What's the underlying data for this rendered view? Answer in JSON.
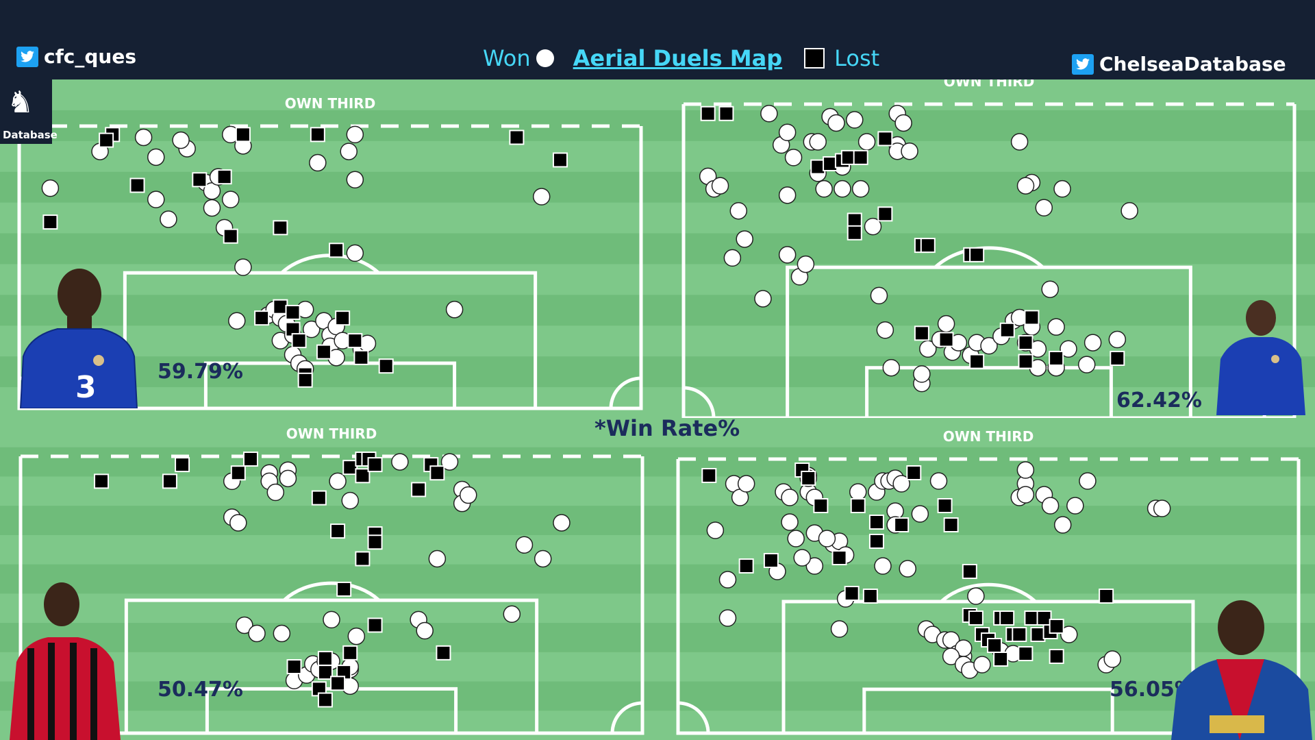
{
  "header": {
    "left_handle": "cfc_ques",
    "right_handle": "ChelseaDatabase",
    "won_label": "Won",
    "title": "Aerial Duels Map",
    "lost_label": "Lost"
  },
  "logo": {
    "text": "Database"
  },
  "win_rate_label": "*Win Rate%",
  "colors": {
    "pitch_dark": "#6fbc7a",
    "pitch_light": "#7ec889",
    "header_bg": "#152033",
    "legend_cyan": "#46d7f7",
    "percent_navy": "#1b2c5c"
  },
  "panels": [
    {
      "zone_label": "OWN THIRD",
      "win_rate": "59.79%",
      "player_kit": "blue",
      "won": [
        [
          0.05,
          0.22
        ],
        [
          0.13,
          0.09
        ],
        [
          0.2,
          0.04
        ],
        [
          0.22,
          0.11
        ],
        [
          0.22,
          0.26
        ],
        [
          0.24,
          0.33
        ],
        [
          0.27,
          0.08
        ],
        [
          0.3,
          0.2
        ],
        [
          0.31,
          0.23
        ],
        [
          0.31,
          0.29
        ],
        [
          0.32,
          0.18
        ],
        [
          0.33,
          0.36
        ],
        [
          0.34,
          0.03
        ],
        [
          0.34,
          0.26
        ],
        [
          0.36,
          0.07
        ],
        [
          0.36,
          0.5
        ],
        [
          0.4,
          0.67
        ],
        [
          0.41,
          0.65
        ],
        [
          0.42,
          0.68
        ],
        [
          0.42,
          0.76
        ],
        [
          0.43,
          0.7
        ],
        [
          0.44,
          0.74
        ],
        [
          0.44,
          0.81
        ],
        [
          0.45,
          0.84
        ],
        [
          0.46,
          0.86
        ],
        [
          0.46,
          0.65
        ],
        [
          0.47,
          0.72
        ],
        [
          0.48,
          0.13
        ],
        [
          0.49,
          0.69
        ],
        [
          0.5,
          0.74
        ],
        [
          0.5,
          0.78
        ],
        [
          0.51,
          0.71
        ],
        [
          0.51,
          0.82
        ],
        [
          0.52,
          0.76
        ],
        [
          0.53,
          0.09
        ],
        [
          0.54,
          0.03
        ],
        [
          0.54,
          0.19
        ],
        [
          0.54,
          0.45
        ],
        [
          0.55,
          0.79
        ],
        [
          0.56,
          0.77
        ],
        [
          0.84,
          0.25
        ],
        [
          0.7,
          0.65
        ],
        [
          0.26,
          0.05
        ],
        [
          0.35,
          0.69
        ]
      ],
      "lost": [
        [
          0.05,
          0.34
        ],
        [
          0.15,
          0.03
        ],
        [
          0.19,
          0.21
        ],
        [
          0.14,
          0.05
        ],
        [
          0.29,
          0.19
        ],
        [
          0.33,
          0.18
        ],
        [
          0.34,
          0.39
        ],
        [
          0.36,
          0.03
        ],
        [
          0.42,
          0.36
        ],
        [
          0.48,
          0.03
        ],
        [
          0.51,
          0.44
        ],
        [
          0.39,
          0.68
        ],
        [
          0.44,
          0.72
        ],
        [
          0.45,
          0.76
        ],
        [
          0.42,
          0.64
        ],
        [
          0.44,
          0.66
        ],
        [
          0.52,
          0.68
        ],
        [
          0.49,
          0.8
        ],
        [
          0.54,
          0.76
        ],
        [
          0.55,
          0.82
        ],
        [
          0.59,
          0.85
        ],
        [
          0.46,
          0.88
        ],
        [
          0.46,
          0.9
        ],
        [
          0.8,
          0.04
        ],
        [
          0.87,
          0.12
        ]
      ]
    },
    {
      "zone_label": "OWN THIRD",
      "win_rate": "62.42%",
      "player_kit": "blue",
      "won": [
        [
          0.04,
          0.23
        ],
        [
          0.05,
          0.27
        ],
        [
          0.06,
          0.26
        ],
        [
          0.08,
          0.49
        ],
        [
          0.09,
          0.34
        ],
        [
          0.1,
          0.43
        ],
        [
          0.14,
          0.03
        ],
        [
          0.13,
          0.62
        ],
        [
          0.16,
          0.13
        ],
        [
          0.17,
          0.09
        ],
        [
          0.17,
          0.29
        ],
        [
          0.17,
          0.48
        ],
        [
          0.18,
          0.17
        ],
        [
          0.19,
          0.55
        ],
        [
          0.2,
          0.51
        ],
        [
          0.21,
          0.12
        ],
        [
          0.22,
          0.22
        ],
        [
          0.22,
          0.12
        ],
        [
          0.23,
          0.27
        ],
        [
          0.24,
          0.04
        ],
        [
          0.25,
          0.06
        ],
        [
          0.26,
          0.27
        ],
        [
          0.26,
          0.2
        ],
        [
          0.28,
          0.05
        ],
        [
          0.29,
          0.27
        ],
        [
          0.3,
          0.12
        ],
        [
          0.31,
          0.39
        ],
        [
          0.32,
          0.61
        ],
        [
          0.33,
          0.72
        ],
        [
          0.34,
          0.84
        ],
        [
          0.35,
          0.13
        ],
        [
          0.35,
          0.15
        ],
        [
          0.35,
          0.03
        ],
        [
          0.36,
          0.06
        ],
        [
          0.37,
          0.15
        ],
        [
          0.39,
          0.89
        ],
        [
          0.39,
          0.86
        ],
        [
          0.4,
          0.78
        ],
        [
          0.42,
          0.75
        ],
        [
          0.44,
          0.79
        ],
        [
          0.43,
          0.7
        ],
        [
          0.45,
          0.76
        ],
        [
          0.47,
          0.8
        ],
        [
          0.48,
          0.76
        ],
        [
          0.5,
          0.77
        ],
        [
          0.52,
          0.74
        ],
        [
          0.54,
          0.69
        ],
        [
          0.56,
          0.76
        ],
        [
          0.57,
          0.71
        ],
        [
          0.58,
          0.84
        ],
        [
          0.58,
          0.78
        ],
        [
          0.55,
          0.68
        ],
        [
          0.61,
          0.71
        ],
        [
          0.61,
          0.84
        ],
        [
          0.63,
          0.78
        ],
        [
          0.6,
          0.59
        ],
        [
          0.57,
          0.25
        ],
        [
          0.56,
          0.26
        ],
        [
          0.59,
          0.33
        ],
        [
          0.55,
          0.12
        ],
        [
          0.62,
          0.27
        ],
        [
          0.66,
          0.83
        ],
        [
          0.71,
          0.75
        ],
        [
          0.73,
          0.34
        ],
        [
          0.67,
          0.76
        ]
      ],
      "lost": [
        [
          0.04,
          0.03
        ],
        [
          0.07,
          0.03
        ],
        [
          0.22,
          0.2
        ],
        [
          0.24,
          0.19
        ],
        [
          0.26,
          0.18
        ],
        [
          0.27,
          0.17
        ],
        [
          0.29,
          0.17
        ],
        [
          0.33,
          0.11
        ],
        [
          0.28,
          0.37
        ],
        [
          0.28,
          0.41
        ],
        [
          0.33,
          0.35
        ],
        [
          0.39,
          0.45
        ],
        [
          0.4,
          0.45
        ],
        [
          0.47,
          0.48
        ],
        [
          0.48,
          0.48
        ],
        [
          0.39,
          0.73
        ],
        [
          0.43,
          0.75
        ],
        [
          0.48,
          0.82
        ],
        [
          0.53,
          0.72
        ],
        [
          0.56,
          0.76
        ],
        [
          0.56,
          0.82
        ],
        [
          0.57,
          0.68
        ],
        [
          0.61,
          0.81
        ],
        [
          0.71,
          0.81
        ]
      ]
    },
    {
      "zone_label": "OWN THIRD",
      "win_rate": "50.47%",
      "player_kit": "red",
      "won": [
        [
          0.34,
          0.09
        ],
        [
          0.34,
          0.22
        ],
        [
          0.4,
          0.06
        ],
        [
          0.4,
          0.09
        ],
        [
          0.41,
          0.13
        ],
        [
          0.43,
          0.05
        ],
        [
          0.51,
          0.09
        ],
        [
          0.53,
          0.16
        ],
        [
          0.61,
          0.02
        ],
        [
          0.69,
          0.02
        ],
        [
          0.71,
          0.12
        ],
        [
          0.71,
          0.17
        ],
        [
          0.72,
          0.14
        ],
        [
          0.87,
          0.24
        ],
        [
          0.81,
          0.32
        ],
        [
          0.84,
          0.37
        ],
        [
          0.67,
          0.37
        ],
        [
          0.36,
          0.61
        ],
        [
          0.38,
          0.64
        ],
        [
          0.42,
          0.64
        ],
        [
          0.44,
          0.81
        ],
        [
          0.46,
          0.79
        ],
        [
          0.47,
          0.75
        ],
        [
          0.48,
          0.77
        ],
        [
          0.5,
          0.59
        ],
        [
          0.49,
          0.74
        ],
        [
          0.5,
          0.74
        ],
        [
          0.53,
          0.83
        ],
        [
          0.53,
          0.77
        ],
        [
          0.54,
          0.65
        ],
        [
          0.53,
          0.76
        ],
        [
          0.64,
          0.59
        ],
        [
          0.65,
          0.63
        ],
        [
          0.79,
          0.57
        ],
        [
          0.35,
          0.24
        ],
        [
          0.43,
          0.08
        ]
      ],
      "lost": [
        [
          0.13,
          0.09
        ],
        [
          0.24,
          0.09
        ],
        [
          0.26,
          0.03
        ],
        [
          0.35,
          0.06
        ],
        [
          0.37,
          0.01
        ],
        [
          0.48,
          0.15
        ],
        [
          0.53,
          0.04
        ],
        [
          0.55,
          0.07
        ],
        [
          0.55,
          0.01
        ],
        [
          0.56,
          0.01
        ],
        [
          0.57,
          0.03
        ],
        [
          0.64,
          0.12
        ],
        [
          0.66,
          0.03
        ],
        [
          0.67,
          0.06
        ],
        [
          0.51,
          0.27
        ],
        [
          0.57,
          0.28
        ],
        [
          0.57,
          0.31
        ],
        [
          0.55,
          0.37
        ],
        [
          0.52,
          0.48
        ],
        [
          0.44,
          0.76
        ],
        [
          0.49,
          0.73
        ],
        [
          0.49,
          0.78
        ],
        [
          0.52,
          0.78
        ],
        [
          0.53,
          0.71
        ],
        [
          0.51,
          0.82
        ],
        [
          0.48,
          0.84
        ],
        [
          0.68,
          0.71
        ],
        [
          0.57,
          0.61
        ],
        [
          0.49,
          0.88
        ]
      ]
    },
    {
      "zone_label": "OWN THIRD",
      "win_rate": "56.05%",
      "player_kit": "crystal",
      "won": [
        [
          0.06,
          0.26
        ],
        [
          0.09,
          0.09
        ],
        [
          0.1,
          0.14
        ],
        [
          0.11,
          0.09
        ],
        [
          0.08,
          0.44
        ],
        [
          0.08,
          0.58
        ],
        [
          0.17,
          0.12
        ],
        [
          0.18,
          0.14
        ],
        [
          0.18,
          0.23
        ],
        [
          0.19,
          0.29
        ],
        [
          0.21,
          0.06
        ],
        [
          0.21,
          0.12
        ],
        [
          0.21,
          0.07
        ],
        [
          0.22,
          0.14
        ],
        [
          0.25,
          0.31
        ],
        [
          0.26,
          0.3
        ],
        [
          0.27,
          0.35
        ],
        [
          0.29,
          0.12
        ],
        [
          0.32,
          0.12
        ],
        [
          0.33,
          0.08
        ],
        [
          0.34,
          0.08
        ],
        [
          0.35,
          0.07
        ],
        [
          0.35,
          0.19
        ],
        [
          0.36,
          0.09
        ],
        [
          0.35,
          0.24
        ],
        [
          0.37,
          0.4
        ],
        [
          0.39,
          0.2
        ],
        [
          0.42,
          0.08
        ],
        [
          0.4,
          0.62
        ],
        [
          0.41,
          0.64
        ],
        [
          0.43,
          0.66
        ],
        [
          0.44,
          0.66
        ],
        [
          0.45,
          0.71
        ],
        [
          0.46,
          0.72
        ],
        [
          0.46,
          0.69
        ],
        [
          0.44,
          0.72
        ],
        [
          0.46,
          0.75
        ],
        [
          0.47,
          0.77
        ],
        [
          0.48,
          0.5
        ],
        [
          0.49,
          0.75
        ],
        [
          0.52,
          0.7
        ],
        [
          0.54,
          0.71
        ],
        [
          0.55,
          0.14
        ],
        [
          0.56,
          0.09
        ],
        [
          0.56,
          0.13
        ],
        [
          0.56,
          0.04
        ],
        [
          0.59,
          0.13
        ],
        [
          0.6,
          0.17
        ],
        [
          0.62,
          0.24
        ],
        [
          0.63,
          0.64
        ],
        [
          0.64,
          0.17
        ],
        [
          0.66,
          0.08
        ],
        [
          0.69,
          0.75
        ],
        [
          0.7,
          0.73
        ],
        [
          0.77,
          0.18
        ],
        [
          0.78,
          0.18
        ],
        [
          0.33,
          0.39
        ],
        [
          0.26,
          0.62
        ],
        [
          0.27,
          0.51
        ],
        [
          0.22,
          0.39
        ],
        [
          0.2,
          0.36
        ],
        [
          0.16,
          0.41
        ],
        [
          0.22,
          0.27
        ],
        [
          0.24,
          0.29
        ]
      ],
      "lost": [
        [
          0.05,
          0.06
        ],
        [
          0.2,
          0.04
        ],
        [
          0.21,
          0.07
        ],
        [
          0.23,
          0.17
        ],
        [
          0.26,
          0.36
        ],
        [
          0.29,
          0.17
        ],
        [
          0.32,
          0.23
        ],
        [
          0.32,
          0.3
        ],
        [
          0.36,
          0.24
        ],
        [
          0.38,
          0.05
        ],
        [
          0.43,
          0.17
        ],
        [
          0.44,
          0.24
        ],
        [
          0.47,
          0.41
        ],
        [
          0.47,
          0.57
        ],
        [
          0.48,
          0.58
        ],
        [
          0.49,
          0.64
        ],
        [
          0.5,
          0.66
        ],
        [
          0.51,
          0.68
        ],
        [
          0.52,
          0.58
        ],
        [
          0.53,
          0.58
        ],
        [
          0.54,
          0.64
        ],
        [
          0.55,
          0.64
        ],
        [
          0.56,
          0.71
        ],
        [
          0.57,
          0.58
        ],
        [
          0.58,
          0.64
        ],
        [
          0.59,
          0.58
        ],
        [
          0.6,
          0.63
        ],
        [
          0.61,
          0.61
        ],
        [
          0.11,
          0.39
        ],
        [
          0.15,
          0.37
        ],
        [
          0.31,
          0.5
        ],
        [
          0.28,
          0.49
        ],
        [
          0.61,
          0.72
        ],
        [
          0.69,
          0.5
        ],
        [
          0.52,
          0.73
        ]
      ]
    }
  ]
}
